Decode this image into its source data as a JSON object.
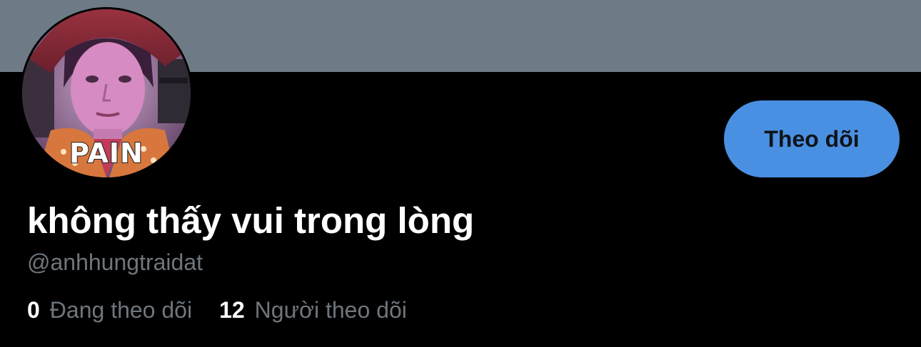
{
  "profile": {
    "display_name": "không thấy vui trong lòng",
    "handle": "@anhhungtraidat",
    "avatar_caption": "PAIN"
  },
  "actions": {
    "follow_label": "Theo dõi"
  },
  "stats": {
    "following_count": "0",
    "following_label": "Đang theo dõi",
    "followers_count": "12",
    "followers_label": "Người theo dõi"
  },
  "colors": {
    "banner": "#6e7b87",
    "background": "#000000",
    "follow_button": "#4a90e2",
    "muted_text": "#6e767d"
  }
}
